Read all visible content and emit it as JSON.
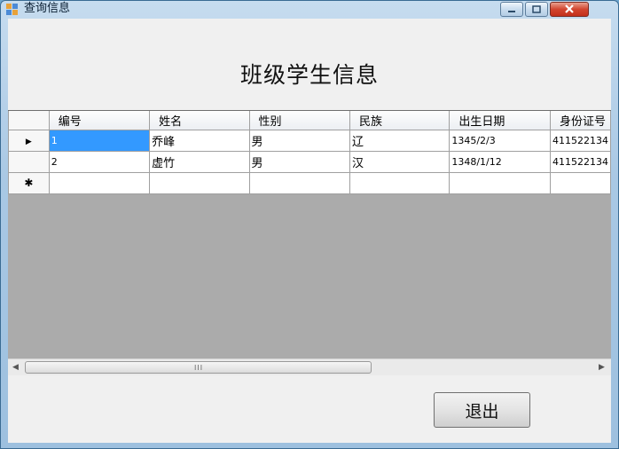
{
  "window": {
    "title": "查询信息",
    "controls": {
      "minimize": "–",
      "maximize": "□",
      "close": "✕"
    }
  },
  "heading": "班级学生信息",
  "grid": {
    "row_marker": "▶",
    "new_row_marker": "✱",
    "columns": [
      "编号",
      "姓名",
      "性别",
      "民族",
      "出生日期",
      "身份证号"
    ],
    "rows": [
      {
        "cells": [
          "1",
          "乔峰",
          "男",
          "辽",
          "1345/2/3",
          "411522134"
        ]
      },
      {
        "cells": [
          "2",
          "虚竹",
          "男",
          "汉",
          "1348/1/12",
          "411522134"
        ]
      }
    ]
  },
  "scrollbar": {
    "left": "◀",
    "right": "▶",
    "grip": "III"
  },
  "exit_button": "退出",
  "colors": {
    "selection": "#3399ff",
    "grid_background": "#ababab"
  }
}
